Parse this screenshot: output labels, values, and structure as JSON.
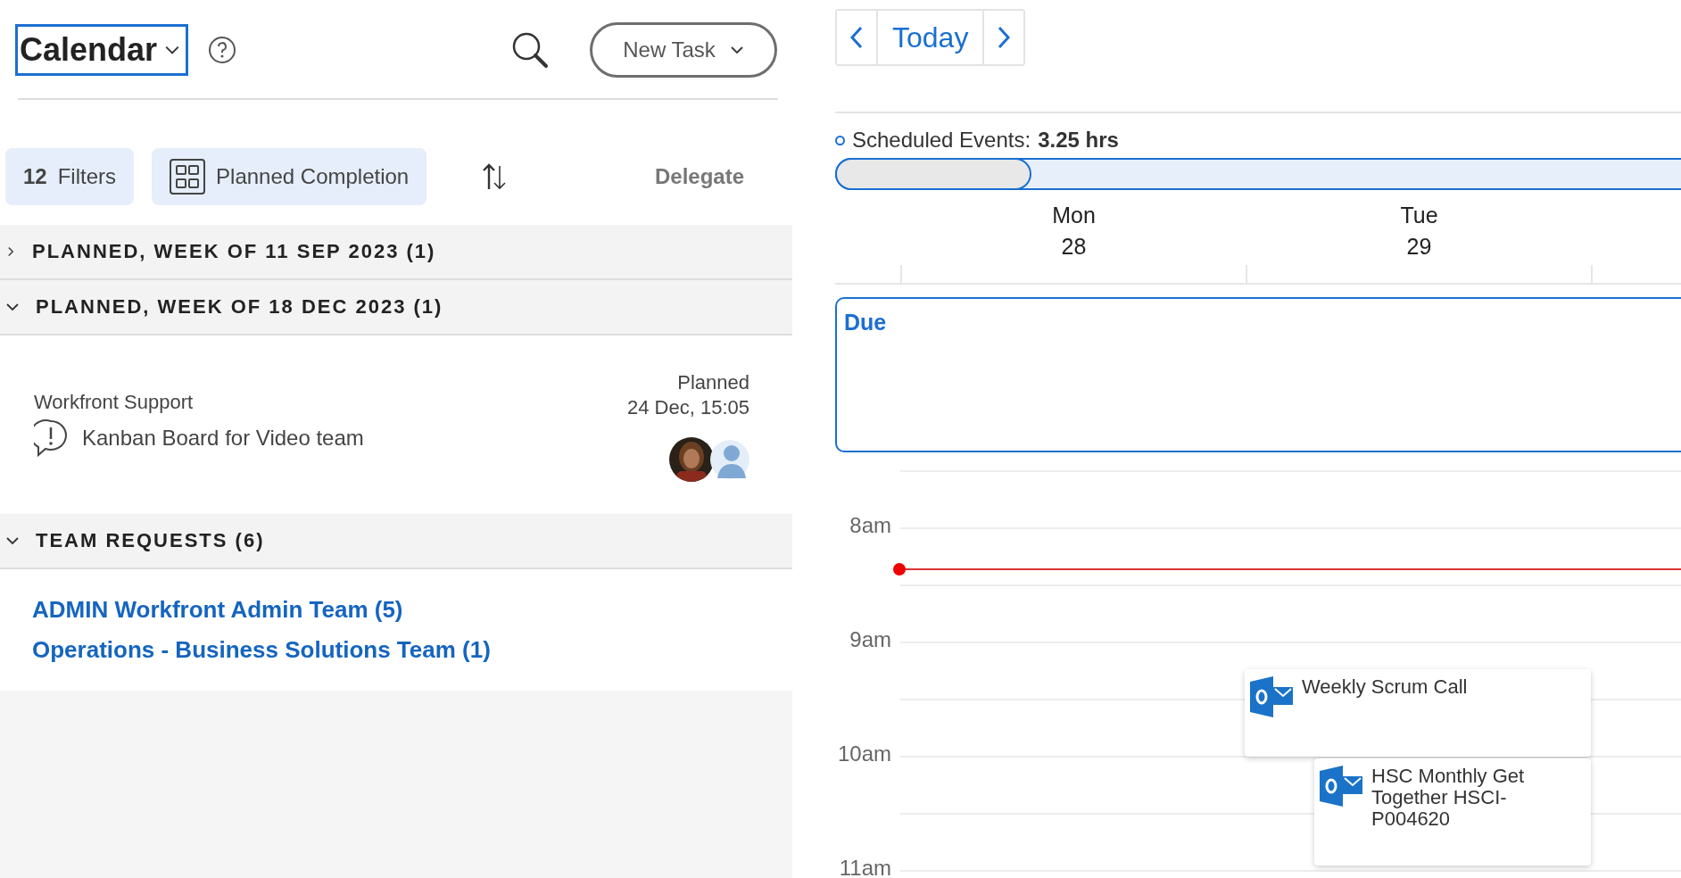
{
  "header": {
    "title": "Calendar",
    "new_task": "New Task"
  },
  "toolbar": {
    "filter_count": "12",
    "filters": "Filters",
    "grouping": "Planned Completion",
    "delegate": "Delegate"
  },
  "groups": [
    {
      "title": "PLANNED, WEEK OF 11 SEP 2023 (1)",
      "expanded": false
    },
    {
      "title": "PLANNED, WEEK OF 18 DEC 2023 (1)",
      "expanded": true,
      "tasks": [
        {
          "project": "Workfront Support",
          "name": "Kanban Board for Video team",
          "status": "Planned",
          "date": "24 Dec, 15:05"
        }
      ]
    },
    {
      "title": "TEAM REQUESTS (6)",
      "expanded": true,
      "links": [
        "ADMIN Workfront Admin Team (5)",
        "Operations - Business Solutions Team (1)"
      ]
    }
  ],
  "calendar": {
    "today": "Today",
    "scheduled": {
      "label": "Scheduled Events:",
      "value": "3.25 hrs",
      "level": 0.23
    },
    "days": [
      {
        "name": "Mon",
        "date": "28"
      },
      {
        "name": "Tue",
        "date": "29"
      }
    ],
    "due_label": "Due",
    "hours": [
      "8am",
      "9am",
      "10am",
      "11am"
    ],
    "events": [
      {
        "title": "Weekly Scrum Call"
      },
      {
        "title": "HSC Monthly Get Together HSCI-P004620"
      }
    ]
  }
}
